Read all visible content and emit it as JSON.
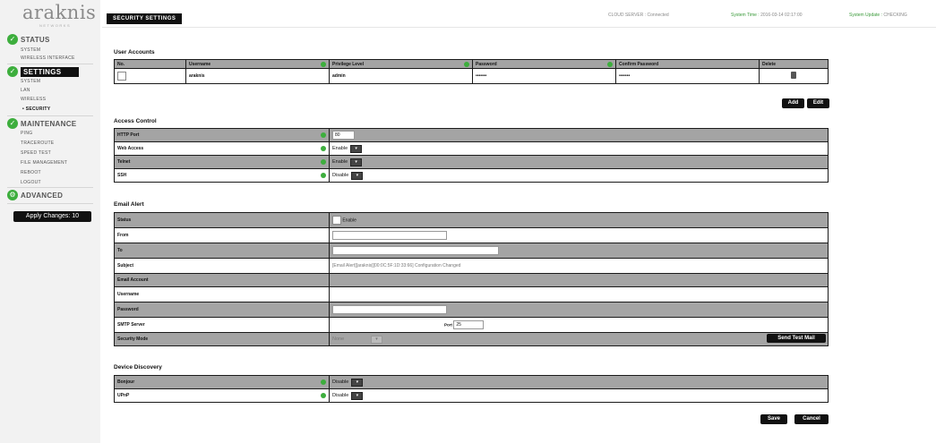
{
  "logo": {
    "text": "araknis",
    "sub": "NETWORKS"
  },
  "sidebar": {
    "sections": [
      {
        "label": "STATUS",
        "items": [
          "SYSTEM",
          "WIRELESS INTERFACE"
        ]
      },
      {
        "label": "SETTINGS",
        "items": [
          "SYSTEM",
          "LAN",
          "WIRELESS",
          "• SECURITY"
        ]
      },
      {
        "label": "MAINTENANCE",
        "items": [
          "PING",
          "TRACEROUTE",
          "SPEED TEST",
          "FILE MANAGEMENT",
          "REBOOT",
          "LOGOUT"
        ]
      },
      {
        "label": "ADVANCED",
        "items": []
      }
    ],
    "apply": "Apply Changes: 10"
  },
  "header": {
    "cloud": "CLOUD SERVER : Connected",
    "systime_label": "System Time :",
    "systime_value": "2016-03-14 02:17:00",
    "update_label": "System Update :",
    "update_value": "CHECKING"
  },
  "page_title": "SECURITY SETTINGS",
  "user_accounts": {
    "title": "User Accounts",
    "headers": [
      "No.",
      "Username",
      "Privilege Level",
      "Password",
      "Confirm Password",
      "Delete"
    ],
    "row": {
      "username": "araknis",
      "privilege": "admin",
      "password": "•••••••",
      "confirm": "•••••••"
    },
    "add": "Add",
    "edit": "Edit"
  },
  "access_control": {
    "title": "Access Control",
    "rows": [
      {
        "label": "HTTP Port",
        "value": "80"
      },
      {
        "label": "Web Access",
        "value": "Enable"
      },
      {
        "label": "Telnet",
        "value": "Enable"
      },
      {
        "label": "SSH",
        "value": "Disable"
      }
    ]
  },
  "email_alert": {
    "title": "Email Alert",
    "status_label": "Status",
    "status_value": "Enable",
    "from_label": "From",
    "to_label": "To",
    "subject_label": "Subject",
    "subject_value": "[Email Alert][araknis][00:0C:5F:1D:33:66] Configuration Changed",
    "account_label": "Email Account",
    "username_label": "Username",
    "password_label": "Password",
    "smtp_label": "SMTP Server",
    "port_label": "Port",
    "port_value": "25",
    "security_label": "Security Mode",
    "security_value": "None",
    "send_test": "Send Test Mail"
  },
  "discovery": {
    "title": "Device Discovery",
    "rows": [
      {
        "label": "Bonjour",
        "value": "Disable"
      },
      {
        "label": "UPnP",
        "value": "Disable"
      }
    ]
  },
  "save": "Save",
  "cancel": "Cancel"
}
